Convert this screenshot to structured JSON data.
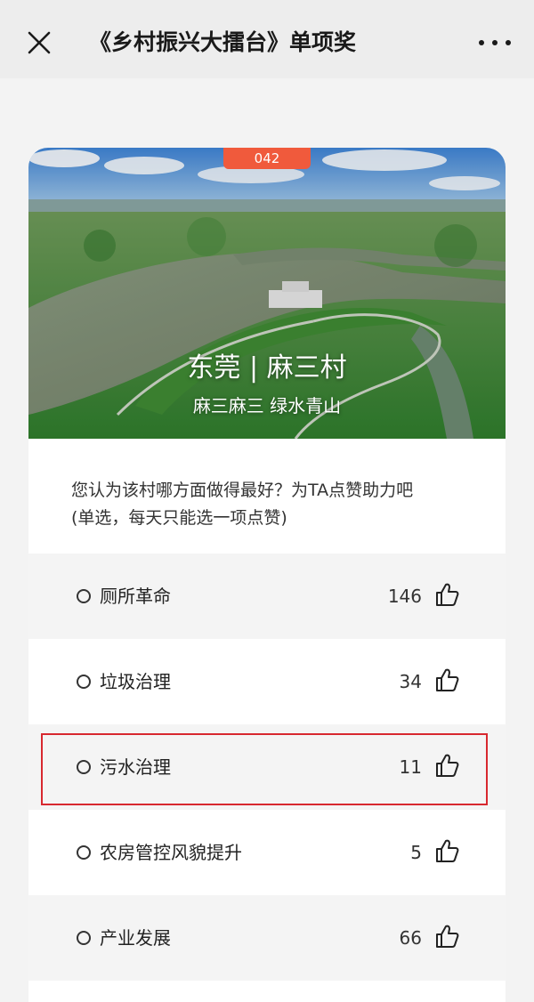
{
  "header": {
    "title": "《乡村振兴大擂台》单项奖",
    "close_icon": "close-icon",
    "more_icon": "more-icon"
  },
  "village": {
    "number": "042",
    "name": "东莞 | 麻三村",
    "slogan": "麻三麻三 绿水青山"
  },
  "prompt": {
    "line1": "您认为该村哪方面做得最好？为TA点赞助力吧",
    "line2": "(单选，每天只能选一项点赞)"
  },
  "options": [
    {
      "label": "厕所革命",
      "count": "146"
    },
    {
      "label": "垃圾治理",
      "count": "34"
    },
    {
      "label": "污水治理",
      "count": "11"
    },
    {
      "label": "农房管控风貌提升",
      "count": "5"
    },
    {
      "label": "产业发展",
      "count": "66"
    }
  ],
  "colors": {
    "badge": "#f05a3c",
    "highlight": "#d8282f"
  }
}
